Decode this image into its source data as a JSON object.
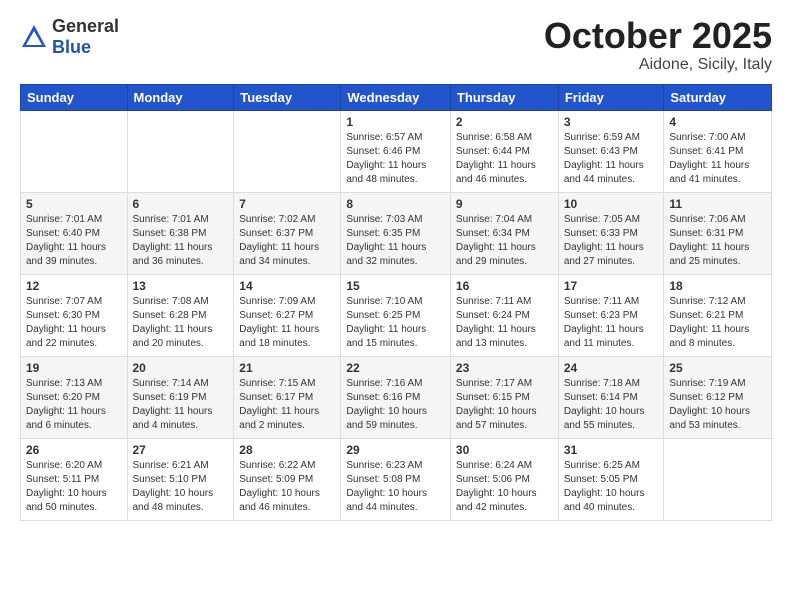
{
  "logo": {
    "general": "General",
    "blue": "Blue"
  },
  "header": {
    "month": "October 2025",
    "location": "Aidone, Sicily, Italy"
  },
  "weekdays": [
    "Sunday",
    "Monday",
    "Tuesday",
    "Wednesday",
    "Thursday",
    "Friday",
    "Saturday"
  ],
  "weeks": [
    [
      {
        "day": "",
        "info": ""
      },
      {
        "day": "",
        "info": ""
      },
      {
        "day": "",
        "info": ""
      },
      {
        "day": "1",
        "info": "Sunrise: 6:57 AM\nSunset: 6:46 PM\nDaylight: 11 hours\nand 48 minutes."
      },
      {
        "day": "2",
        "info": "Sunrise: 6:58 AM\nSunset: 6:44 PM\nDaylight: 11 hours\nand 46 minutes."
      },
      {
        "day": "3",
        "info": "Sunrise: 6:59 AM\nSunset: 6:43 PM\nDaylight: 11 hours\nand 44 minutes."
      },
      {
        "day": "4",
        "info": "Sunrise: 7:00 AM\nSunset: 6:41 PM\nDaylight: 11 hours\nand 41 minutes."
      }
    ],
    [
      {
        "day": "5",
        "info": "Sunrise: 7:01 AM\nSunset: 6:40 PM\nDaylight: 11 hours\nand 39 minutes."
      },
      {
        "day": "6",
        "info": "Sunrise: 7:01 AM\nSunset: 6:38 PM\nDaylight: 11 hours\nand 36 minutes."
      },
      {
        "day": "7",
        "info": "Sunrise: 7:02 AM\nSunset: 6:37 PM\nDaylight: 11 hours\nand 34 minutes."
      },
      {
        "day": "8",
        "info": "Sunrise: 7:03 AM\nSunset: 6:35 PM\nDaylight: 11 hours\nand 32 minutes."
      },
      {
        "day": "9",
        "info": "Sunrise: 7:04 AM\nSunset: 6:34 PM\nDaylight: 11 hours\nand 29 minutes."
      },
      {
        "day": "10",
        "info": "Sunrise: 7:05 AM\nSunset: 6:33 PM\nDaylight: 11 hours\nand 27 minutes."
      },
      {
        "day": "11",
        "info": "Sunrise: 7:06 AM\nSunset: 6:31 PM\nDaylight: 11 hours\nand 25 minutes."
      }
    ],
    [
      {
        "day": "12",
        "info": "Sunrise: 7:07 AM\nSunset: 6:30 PM\nDaylight: 11 hours\nand 22 minutes."
      },
      {
        "day": "13",
        "info": "Sunrise: 7:08 AM\nSunset: 6:28 PM\nDaylight: 11 hours\nand 20 minutes."
      },
      {
        "day": "14",
        "info": "Sunrise: 7:09 AM\nSunset: 6:27 PM\nDaylight: 11 hours\nand 18 minutes."
      },
      {
        "day": "15",
        "info": "Sunrise: 7:10 AM\nSunset: 6:25 PM\nDaylight: 11 hours\nand 15 minutes."
      },
      {
        "day": "16",
        "info": "Sunrise: 7:11 AM\nSunset: 6:24 PM\nDaylight: 11 hours\nand 13 minutes."
      },
      {
        "day": "17",
        "info": "Sunrise: 7:11 AM\nSunset: 6:23 PM\nDaylight: 11 hours\nand 11 minutes."
      },
      {
        "day": "18",
        "info": "Sunrise: 7:12 AM\nSunset: 6:21 PM\nDaylight: 11 hours\nand 8 minutes."
      }
    ],
    [
      {
        "day": "19",
        "info": "Sunrise: 7:13 AM\nSunset: 6:20 PM\nDaylight: 11 hours\nand 6 minutes."
      },
      {
        "day": "20",
        "info": "Sunrise: 7:14 AM\nSunset: 6:19 PM\nDaylight: 11 hours\nand 4 minutes."
      },
      {
        "day": "21",
        "info": "Sunrise: 7:15 AM\nSunset: 6:17 PM\nDaylight: 11 hours\nand 2 minutes."
      },
      {
        "day": "22",
        "info": "Sunrise: 7:16 AM\nSunset: 6:16 PM\nDaylight: 10 hours\nand 59 minutes."
      },
      {
        "day": "23",
        "info": "Sunrise: 7:17 AM\nSunset: 6:15 PM\nDaylight: 10 hours\nand 57 minutes."
      },
      {
        "day": "24",
        "info": "Sunrise: 7:18 AM\nSunset: 6:14 PM\nDaylight: 10 hours\nand 55 minutes."
      },
      {
        "day": "25",
        "info": "Sunrise: 7:19 AM\nSunset: 6:12 PM\nDaylight: 10 hours\nand 53 minutes."
      }
    ],
    [
      {
        "day": "26",
        "info": "Sunrise: 6:20 AM\nSunset: 5:11 PM\nDaylight: 10 hours\nand 50 minutes."
      },
      {
        "day": "27",
        "info": "Sunrise: 6:21 AM\nSunset: 5:10 PM\nDaylight: 10 hours\nand 48 minutes."
      },
      {
        "day": "28",
        "info": "Sunrise: 6:22 AM\nSunset: 5:09 PM\nDaylight: 10 hours\nand 46 minutes."
      },
      {
        "day": "29",
        "info": "Sunrise: 6:23 AM\nSunset: 5:08 PM\nDaylight: 10 hours\nand 44 minutes."
      },
      {
        "day": "30",
        "info": "Sunrise: 6:24 AM\nSunset: 5:06 PM\nDaylight: 10 hours\nand 42 minutes."
      },
      {
        "day": "31",
        "info": "Sunrise: 6:25 AM\nSunset: 5:05 PM\nDaylight: 10 hours\nand 40 minutes."
      },
      {
        "day": "",
        "info": ""
      }
    ]
  ]
}
